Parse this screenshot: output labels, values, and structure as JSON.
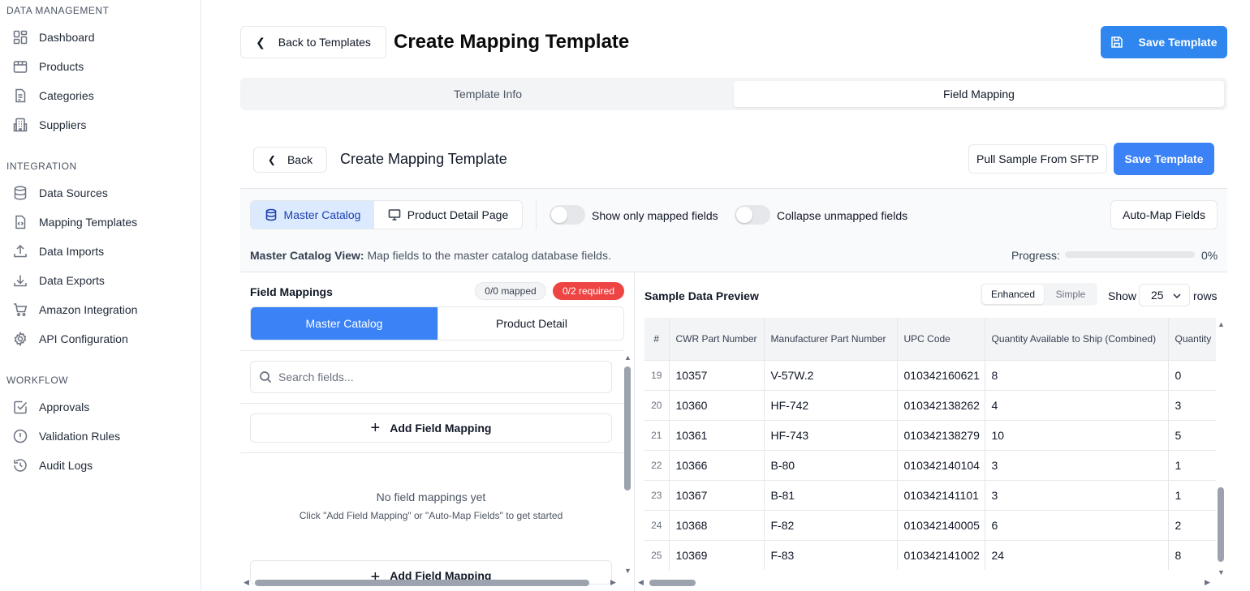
{
  "sidebar": {
    "sections": [
      {
        "title": "DATA MANAGEMENT",
        "items": [
          {
            "label": "Dashboard",
            "icon": "dashboard-icon"
          },
          {
            "label": "Products",
            "icon": "package-icon"
          },
          {
            "label": "Categories",
            "icon": "document-icon"
          },
          {
            "label": "Suppliers",
            "icon": "building-icon"
          }
        ]
      },
      {
        "title": "INTEGRATION",
        "items": [
          {
            "label": "Data Sources",
            "icon": "database-icon"
          },
          {
            "label": "Mapping Templates",
            "icon": "file-code-icon"
          },
          {
            "label": "Data Imports",
            "icon": "upload-icon"
          },
          {
            "label": "Data Exports",
            "icon": "download-icon"
          },
          {
            "label": "Amazon Integration",
            "icon": "cart-icon"
          },
          {
            "label": "API Configuration",
            "icon": "gear-icon"
          }
        ]
      },
      {
        "title": "WORKFLOW",
        "items": [
          {
            "label": "Approvals",
            "icon": "check-square-icon"
          },
          {
            "label": "Validation Rules",
            "icon": "alert-circle-icon"
          },
          {
            "label": "Audit Logs",
            "icon": "history-icon"
          }
        ]
      }
    ]
  },
  "header": {
    "back_label": "Back to Templates",
    "title": "Create Mapping Template",
    "save_label": "Save Template",
    "tabs": [
      "Template Info",
      "Field Mapping"
    ]
  },
  "sub_header": {
    "back_label": "Back",
    "title": "Create Mapping Template",
    "pull_label": "Pull Sample From SFTP",
    "save_label": "Save Template"
  },
  "toolbar": {
    "view_master": "Master Catalog",
    "view_product": "Product Detail Page",
    "toggle_mapped": "Show only mapped fields",
    "toggle_collapse": "Collapse unmapped fields",
    "auto_map": "Auto-Map Fields",
    "info_bold": "Master Catalog View:",
    "info_text": " Map fields to the master catalog database fields.",
    "progress_label": "Progress:",
    "progress_value": 0,
    "progress_text": "0%"
  },
  "field_mappings": {
    "title": "Field Mappings",
    "mapped_badge": "0/0 mapped",
    "required_badge": "0/2 required",
    "seg_master": "Master Catalog",
    "seg_product": "Product Detail",
    "search_placeholder": "Search fields...",
    "add_label": "Add Field Mapping",
    "empty_title": "No field mappings yet",
    "empty_sub": "Click \"Add Field Mapping\" or \"Auto-Map Fields\" to get started"
  },
  "preview": {
    "title": "Sample Data Preview",
    "mode_enhanced": "Enhanced",
    "mode_simple": "Simple",
    "show_label": "Show",
    "rows_value": "25",
    "rows_label": "rows",
    "columns": [
      "#",
      "CWR Part Number",
      "Manufacturer Part Number",
      "UPC Code",
      "Quantity Available to Ship (Combined)",
      "Quantity"
    ],
    "rows": [
      [
        "19",
        "10357",
        "V-57W.2",
        "010342160621",
        "8",
        "0"
      ],
      [
        "20",
        "10360",
        "HF-742",
        "010342138262",
        "4",
        "3"
      ],
      [
        "21",
        "10361",
        "HF-743",
        "010342138279",
        "10",
        "5"
      ],
      [
        "22",
        "10366",
        "B-80",
        "010342140104",
        "3",
        "1"
      ],
      [
        "23",
        "10367",
        "B-81",
        "010342141101",
        "3",
        "1"
      ],
      [
        "24",
        "10368",
        "F-82",
        "010342140005",
        "6",
        "2"
      ],
      [
        "25",
        "10369",
        "F-83",
        "010342141002",
        "24",
        "8"
      ]
    ]
  },
  "colors": {
    "primary": "#2f86ee",
    "danger": "#ef4444",
    "border": "#e5e7eb"
  }
}
